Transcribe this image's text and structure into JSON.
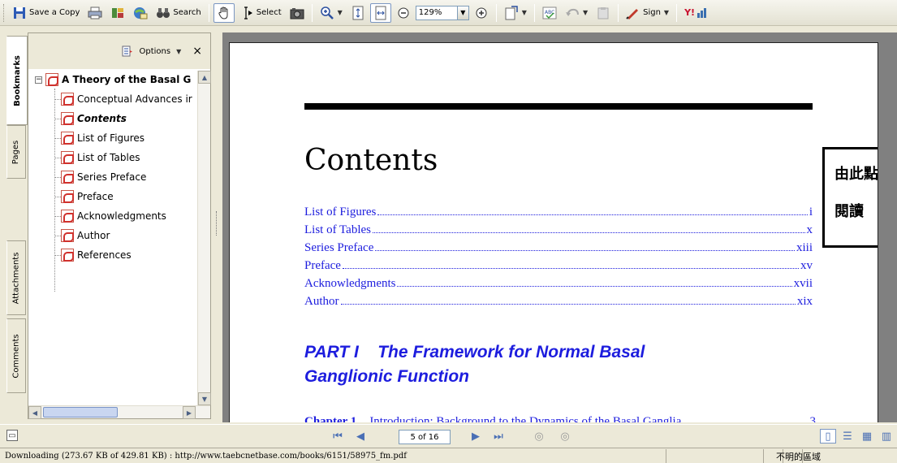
{
  "toolbar": {
    "save_copy": "Save a Copy",
    "search": "Search",
    "select": "Select",
    "zoom": "129%",
    "sign": "Sign",
    "yahoo": "Y!"
  },
  "side_tabs": {
    "bookmarks": "Bookmarks",
    "pages": "Pages",
    "attachments": "Attachments",
    "comments": "Comments"
  },
  "bookmarks_panel": {
    "options_label": "Options",
    "close": "×",
    "root": "A Theory of the Basal G",
    "items": [
      "Conceptual Advances ir",
      "Contents",
      "List of Figures",
      "List of Tables",
      "Series Preface",
      "Preface",
      "Acknowledgments",
      "Author",
      "References"
    ]
  },
  "document": {
    "heading": "Contents",
    "toc": [
      {
        "label": "List of Figures",
        "page": "i"
      },
      {
        "label": "List of Tables",
        "page": "x"
      },
      {
        "label": "Series Preface",
        "page": "xiii"
      },
      {
        "label": "Preface",
        "page": "xv"
      },
      {
        "label": "Acknowledgments",
        "page": "xvii"
      },
      {
        "label": "Author",
        "page": "xix"
      }
    ],
    "part_line1": "PART I    The Framework for Normal Basal",
    "part_line2": "Ganglionic Function",
    "chapter_num": "Chapter 1",
    "chapter_title": "Introduction: Background to the Dynamics of the Basal Ganglia",
    "chapter_page": "3"
  },
  "popup": {
    "line1": "由此點進",
    "line2": "閱讀"
  },
  "navigation": {
    "page_indicator": "5 of 16"
  },
  "status": {
    "download_text": "Downloading (273.67 KB of 429.81 KB) : http://www.taebcnetbase.com/books/6151/58975_fm.pdf",
    "zone": "不明的區域"
  },
  "colors": {
    "link_blue": "#1d1dde",
    "chrome": "#ece9d8",
    "doc_bg": "#808080"
  }
}
